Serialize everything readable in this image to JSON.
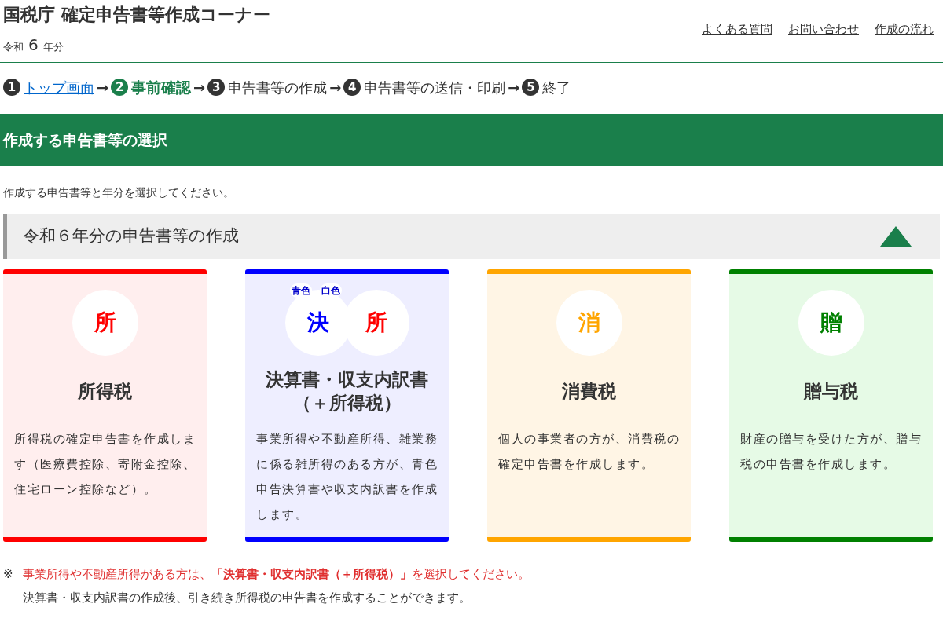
{
  "header": {
    "title": "国税庁 確定申告書等作成コーナー",
    "year_prefix": "令和",
    "year": "6",
    "year_suffix": "年分",
    "links": [
      "よくある質問",
      "お問い合わせ",
      "作成の流れ"
    ]
  },
  "steps": [
    {
      "number": "1",
      "label": "トップ画面",
      "kind": "link"
    },
    {
      "number": "2",
      "label": "事前確認",
      "kind": "current"
    },
    {
      "number": "3",
      "label": "申告書等の作成",
      "kind": "upcoming"
    },
    {
      "number": "4",
      "label": "申告書等の送信・印刷",
      "kind": "upcoming"
    },
    {
      "number": "5",
      "label": "終了",
      "kind": "upcoming"
    }
  ],
  "step_arrow": "→",
  "page_heading": "作成する申告書等の選択",
  "instruction": "作成する申告書等と年分を選択してください。",
  "section": {
    "title": "令和６年分の申告書等の作成",
    "expanded": true,
    "cards": [
      {
        "color": "#ff0000",
        "badges": [
          {
            "char": "所",
            "color": "#ff0000"
          }
        ],
        "title": "所得税",
        "description": "所得税の確定申告書を作成します（医療費控除、寄附金控除、住宅ローン控除など）。"
      },
      {
        "color": "#0000ff",
        "tags": [
          "青色",
          "白色"
        ],
        "badges": [
          {
            "char": "決",
            "color": "#0000ff"
          },
          {
            "char": "所",
            "color": "#ff0000"
          }
        ],
        "title": "決算書・収支内訳書（＋所得税）",
        "description": "事業所得や不動産所得、雑業務に係る雑所得のある方が、青色申告決算書や収支内訳書を作成します。"
      },
      {
        "color": "#ffa500",
        "badges": [
          {
            "char": "消",
            "color": "#ffa500"
          }
        ],
        "title": "消費税",
        "description": "個人の事業者の方が、消費税の確定申告書を作成します。"
      },
      {
        "color": "#008000",
        "badges": [
          {
            "char": "贈",
            "color": "#008000"
          }
        ],
        "title": "贈与税",
        "description": "財産の贈与を受けた方が、贈与税の申告書を作成します。"
      }
    ]
  },
  "notes": {
    "mark": "※",
    "warning": "事業所得や不動産所得がある方は、**「決算書・収支内訳書（＋所得税）」**を選択してください。",
    "detail": "決算書・収支内訳書の作成後、引き続き所得税の申告書を作成することができます。"
  }
}
